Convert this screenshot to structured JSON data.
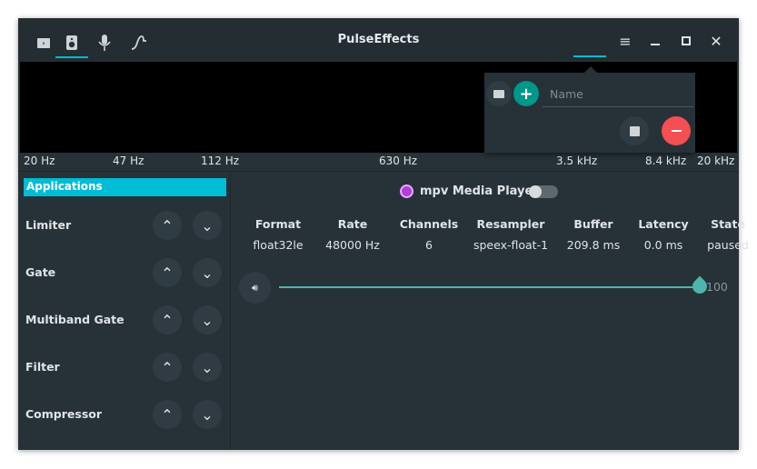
{
  "header": {
    "title": "PulseEffects",
    "tabs": [
      "applications-tab",
      "speaker-tab",
      "microphone-tab",
      "spectrum-tab"
    ],
    "active_tab": 1
  },
  "spectrum": {
    "freq_labels": [
      "20 Hz",
      "47 Hz",
      "112 Hz",
      "630 Hz",
      "3.5 kHz",
      "8.4 kHz",
      "20 kHz"
    ]
  },
  "sidebar": {
    "selected": "Applications",
    "items": [
      {
        "label": "Limiter"
      },
      {
        "label": "Gate"
      },
      {
        "label": "Multiband Gate"
      },
      {
        "label": "Filter"
      },
      {
        "label": "Compressor"
      }
    ]
  },
  "app": {
    "name": "mpv Media Player",
    "enabled": false,
    "columns": [
      {
        "h": "Format",
        "v": "float32le"
      },
      {
        "h": "Rate",
        "v": "48000 Hz"
      },
      {
        "h": "Channels",
        "v": "6"
      },
      {
        "h": "Resampler",
        "v": "speex-float-1"
      },
      {
        "h": "Buffer",
        "v": "209.8 ms"
      },
      {
        "h": "Latency",
        "v": "0.0 ms"
      },
      {
        "h": "State",
        "v": "paused"
      }
    ],
    "volume": "100",
    "volume_fraction": 1.0
  },
  "presets": {
    "name_placeholder": "Name"
  },
  "colors": {
    "accent": "#00bcd4",
    "add": "#009688",
    "remove": "#f44f53",
    "slider": "#4db6ac"
  }
}
